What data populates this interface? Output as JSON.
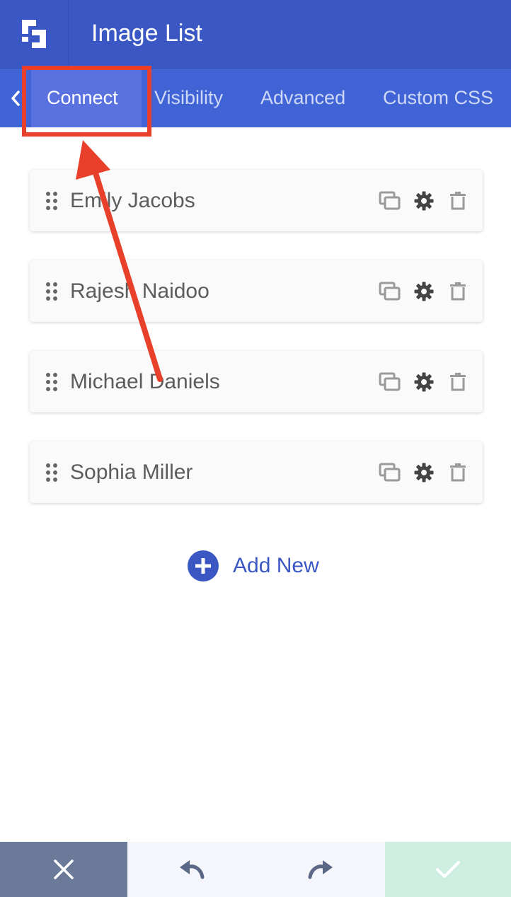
{
  "header": {
    "title": "Image List",
    "logo_icon": "brand-logo-icon"
  },
  "tabs": {
    "items": [
      {
        "label": "Connect",
        "active": true
      },
      {
        "label": "Visibility",
        "active": false
      },
      {
        "label": "Advanced",
        "active": false
      },
      {
        "label": "Custom CSS",
        "active": false
      }
    ]
  },
  "list": {
    "items": [
      {
        "label": "Emily Jacobs"
      },
      {
        "label": "Rajesh Naidoo"
      },
      {
        "label": "Michael Daniels"
      },
      {
        "label": "Sophia Miller"
      }
    ],
    "add_label": "Add New"
  },
  "footer": {
    "cancel_icon": "close-icon",
    "undo_icon": "undo-icon",
    "redo_icon": "redo-icon",
    "save_icon": "check-icon"
  },
  "colors": {
    "header": "#3a57c4",
    "tabs": "#4064d6",
    "annotation": "#e8402b",
    "cancel": "#6b7a99",
    "save": "#cdeee0"
  }
}
